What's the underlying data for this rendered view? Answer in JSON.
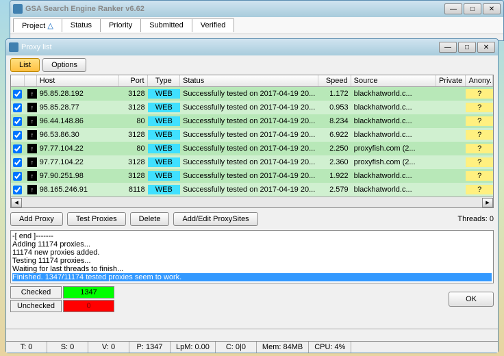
{
  "main_window": {
    "title": "GSA Search Engine Ranker v6.62",
    "tabs": [
      "Project",
      "Status",
      "Priority",
      "Submitted",
      "Verified"
    ]
  },
  "proxy_window": {
    "title": "Proxy list",
    "toolbar": {
      "list": "List",
      "options": "Options"
    },
    "columns": {
      "host": "Host",
      "port": "Port",
      "type": "Type",
      "status": "Status",
      "speed": "Speed",
      "source": "Source",
      "private": "Private",
      "anon": "Anony..."
    },
    "rows": [
      {
        "host": "95.85.28.192",
        "port": "3128",
        "type": "WEB",
        "status": "Successfully tested on 2017-04-19 20...",
        "speed": "1.172",
        "source": "blackhatworld.c...",
        "private": "",
        "anon": "?",
        "shade": "green"
      },
      {
        "host": "95.85.28.77",
        "port": "3128",
        "type": "WEB",
        "status": "Successfully tested on 2017-04-19 20...",
        "speed": "0.953",
        "source": "blackhatworld.c...",
        "private": "",
        "anon": "?",
        "shade": "lightgreen"
      },
      {
        "host": "96.44.148.86",
        "port": "80",
        "type": "WEB",
        "status": "Successfully tested on 2017-04-19 20...",
        "speed": "8.234",
        "source": "blackhatworld.c...",
        "private": "",
        "anon": "?",
        "shade": "green"
      },
      {
        "host": "96.53.86.30",
        "port": "3128",
        "type": "WEB",
        "status": "Successfully tested on 2017-04-19 20...",
        "speed": "6.922",
        "source": "blackhatworld.c...",
        "private": "",
        "anon": "?",
        "shade": "lightgreen"
      },
      {
        "host": "97.77.104.22",
        "port": "80",
        "type": "WEB",
        "status": "Successfully tested on 2017-04-19 20...",
        "speed": "2.250",
        "source": "proxyfish.com (2...",
        "private": "",
        "anon": "?",
        "shade": "green"
      },
      {
        "host": "97.77.104.22",
        "port": "3128",
        "type": "WEB",
        "status": "Successfully tested on 2017-04-19 20...",
        "speed": "2.360",
        "source": "proxyfish.com (2...",
        "private": "",
        "anon": "?",
        "shade": "lightgreen"
      },
      {
        "host": "97.90.251.98",
        "port": "3128",
        "type": "WEB",
        "status": "Successfully tested on 2017-04-19 20...",
        "speed": "1.922",
        "source": "blackhatworld.c...",
        "private": "",
        "anon": "?",
        "shade": "green"
      },
      {
        "host": "98.165.246.91",
        "port": "8118",
        "type": "WEB",
        "status": "Successfully tested on 2017-04-19 20...",
        "speed": "2.579",
        "source": "blackhatworld.c...",
        "private": "",
        "anon": "?",
        "shade": "lightgreen"
      }
    ],
    "actions": {
      "add_proxy": "Add Proxy",
      "test_proxies": "Test Proxies",
      "delete": "Delete",
      "add_edit_sites": "Add/Edit ProxySites",
      "threads": "Threads: 0"
    },
    "log": [
      "-[ end ]-------",
      "Adding 11174 proxies...",
      "11174 new proxies added.",
      "Testing 11174 proxies...",
      "Waiting for last threads to finish...",
      "Finished. 1347/11174 tested proxies seem to work."
    ],
    "status": {
      "checked_label": "Checked",
      "checked_val": "1347",
      "unchecked_label": "Unchecked",
      "unchecked_val": "0",
      "ok": "OK"
    },
    "footer": {
      "t": "T: 0",
      "s": "S: 0",
      "v": "V: 0",
      "p": "P: 1347",
      "lpm": "LpM: 0.00",
      "c": "C: 0|0",
      "mem": "Mem: 84MB",
      "cpu": "CPU: 4%"
    }
  }
}
